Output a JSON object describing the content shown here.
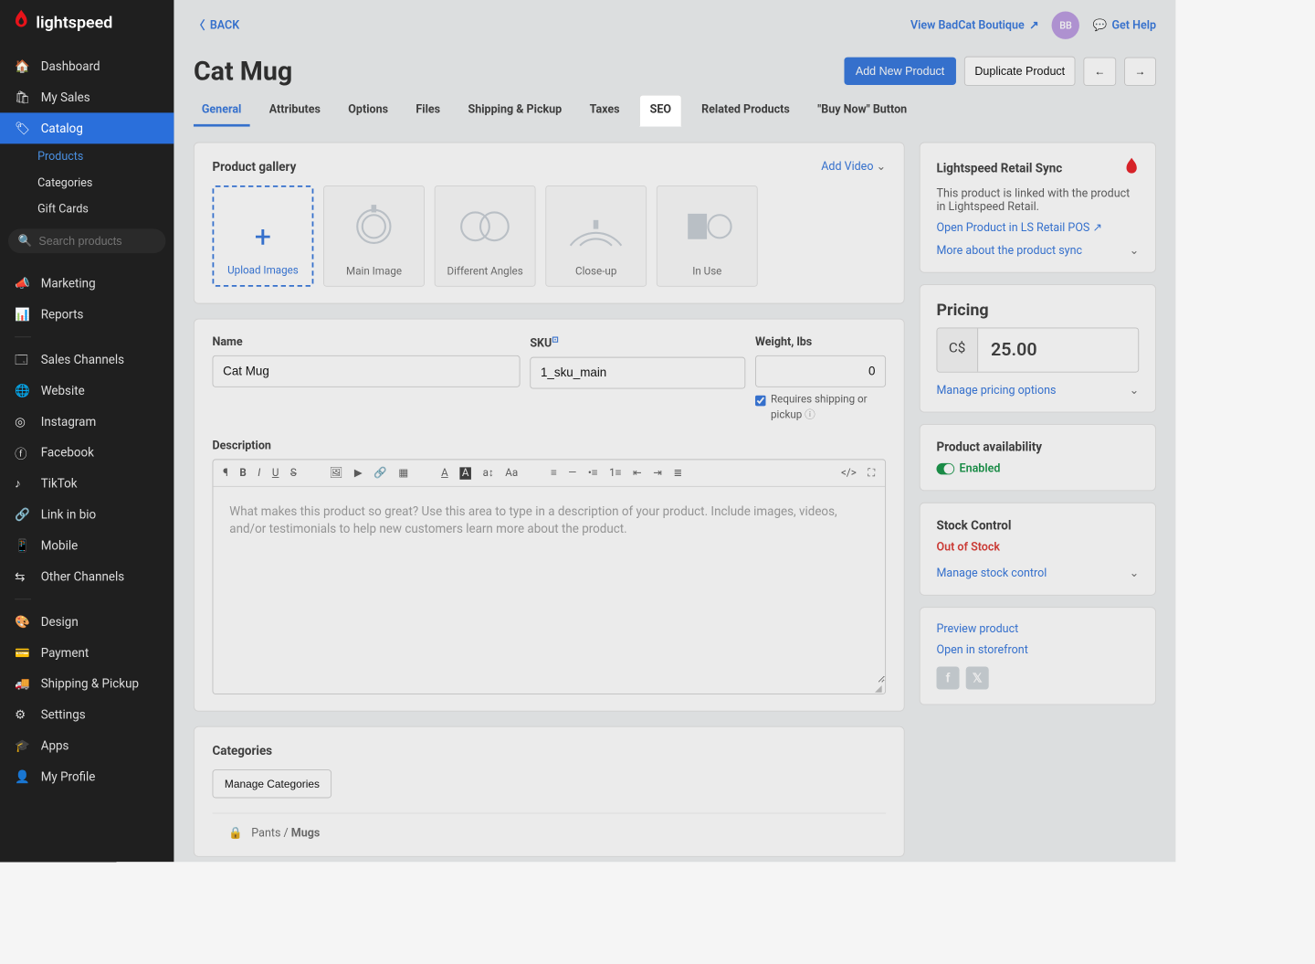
{
  "brand": "lightspeed",
  "sidebar": {
    "items": [
      {
        "label": "Dashboard",
        "icon": "home"
      },
      {
        "label": "My Sales",
        "icon": "basket"
      },
      {
        "label": "Catalog",
        "icon": "tag",
        "active": true
      },
      {
        "label": "Marketing",
        "icon": "megaphone"
      },
      {
        "label": "Reports",
        "icon": "bars"
      },
      {
        "label": "Sales Channels",
        "icon": "window"
      },
      {
        "label": "Website",
        "icon": "globe"
      },
      {
        "label": "Instagram",
        "icon": "ig"
      },
      {
        "label": "Facebook",
        "icon": "fb"
      },
      {
        "label": "TikTok",
        "icon": "tiktok"
      },
      {
        "label": "Link in bio",
        "icon": "link"
      },
      {
        "label": "Mobile",
        "icon": "mobile"
      },
      {
        "label": "Other Channels",
        "icon": "branch"
      },
      {
        "label": "Design",
        "icon": "palette"
      },
      {
        "label": "Payment",
        "icon": "wallet"
      },
      {
        "label": "Shipping & Pickup",
        "icon": "truck"
      },
      {
        "label": "Settings",
        "icon": "gear"
      },
      {
        "label": "Apps",
        "icon": "apps"
      },
      {
        "label": "My Profile",
        "icon": "user"
      }
    ],
    "sub_catalog": [
      "Products",
      "Categories",
      "Gift Cards"
    ],
    "search_placeholder": "Search products"
  },
  "topbar": {
    "back": "BACK",
    "view_store": "View BadCat Boutique",
    "avatar": "BB",
    "help": "Get Help"
  },
  "page": {
    "title": "Cat Mug",
    "add_btn": "Add New Product",
    "dup_btn": "Duplicate Product"
  },
  "tabs": [
    "General",
    "Attributes",
    "Options",
    "Files",
    "Shipping & Pickup",
    "Taxes",
    "SEO",
    "Related Products",
    "\"Buy Now\" Button"
  ],
  "gallery": {
    "title": "Product gallery",
    "add_video": "Add Video",
    "upload": "Upload Images",
    "items": [
      "Main Image",
      "Different Angles",
      "Close-up",
      "In Use"
    ]
  },
  "form": {
    "name_label": "Name",
    "name_value": "Cat Mug",
    "sku_label": "SKU",
    "sku_value": "1_sku_main",
    "weight_label": "Weight, lbs",
    "weight_value": "0",
    "requires_shipping": "Requires shipping or pickup",
    "desc_label": "Description",
    "desc_placeholder": "What makes this product so great? Use this area to type in a description of your product. Include images, videos, and/or testimonials to help new customers learn more about the product."
  },
  "categories": {
    "title": "Categories",
    "manage": "Manage Categories",
    "path_parent": "Pants",
    "path_child": "Mugs"
  },
  "side": {
    "sync_title": "Lightspeed Retail Sync",
    "sync_body": "This product is linked with the product in Lightspeed Retail.",
    "sync_open": "Open Product in LS Retail POS",
    "sync_more": "More about the product sync",
    "pricing_title": "Pricing",
    "currency": "C$",
    "price": "25.00",
    "manage_pricing": "Manage pricing options",
    "avail_title": "Product availability",
    "avail_status": "Enabled",
    "stock_title": "Stock Control",
    "stock_status": "Out of Stock",
    "manage_stock": "Manage stock control",
    "preview": "Preview product",
    "open_store": "Open in storefront"
  }
}
